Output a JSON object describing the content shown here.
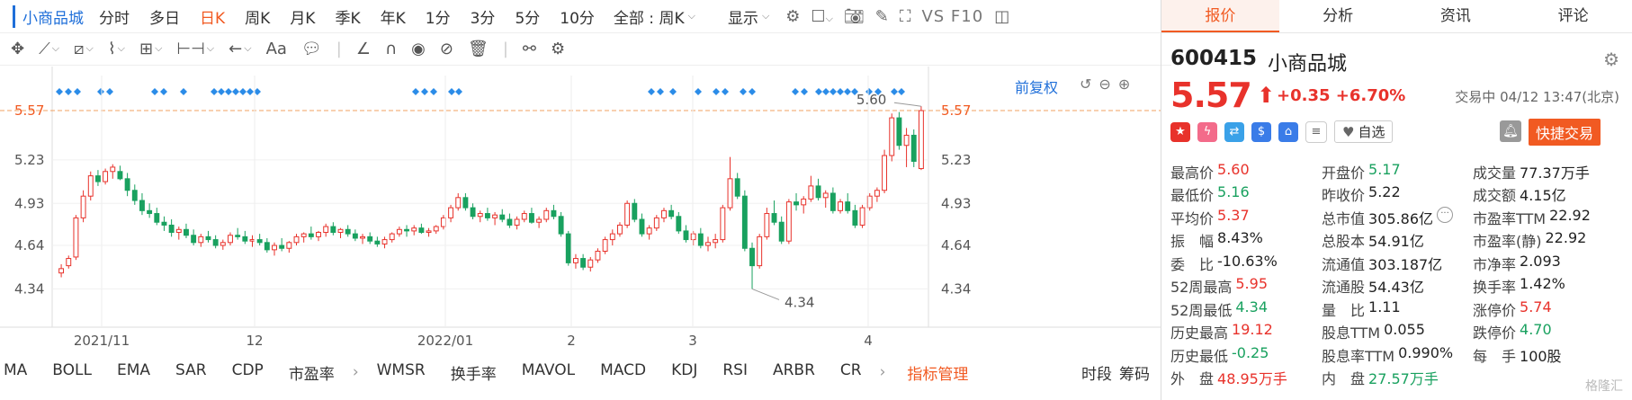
{
  "toolbar": {
    "stock_name": "小商品城",
    "periods": [
      "分时",
      "多日",
      "日K",
      "周K",
      "月K",
      "季K",
      "年K",
      "1分",
      "3分",
      "5分",
      "10分"
    ],
    "active_period": "日K",
    "period_dropdown": "全部 : 周K",
    "display_label": "显示",
    "vs_f10": "VS F10"
  },
  "drawing_tools_icons": [
    "crosshair-icon",
    "line-icon",
    "channel-icon",
    "wave-icon",
    "fib-icon",
    "range-icon",
    "arrow-icon",
    "text-icon",
    "comment-icon",
    "pen-icon",
    "magnet-icon",
    "eye-icon",
    "hide-icon",
    "delete-icon",
    "link-icon",
    "gear-icon"
  ],
  "chart": {
    "fuquan": "前复权",
    "y_ticks": [
      "5.57",
      "5.23",
      "4.93",
      "4.64",
      "4.34"
    ],
    "right_ticks": [
      "5.57",
      "5.23",
      "4.93",
      "4.64",
      "4.34"
    ],
    "x_ticks": [
      "2021/11",
      "12",
      "2022/01",
      "2",
      "3",
      "4"
    ],
    "high_label": "5.60",
    "low_label": "4.34"
  },
  "chart_data": {
    "type": "candlestick",
    "current_price": 5.57,
    "ylim": [
      4.2,
      5.75
    ],
    "candles": [
      [
        4.45,
        4.51,
        4.42,
        4.48
      ],
      [
        4.5,
        4.57,
        4.48,
        4.55
      ],
      [
        4.56,
        4.85,
        4.54,
        4.83
      ],
      [
        4.83,
        5.02,
        4.8,
        4.98
      ],
      [
        4.98,
        5.15,
        4.95,
        5.12
      ],
      [
        5.12,
        5.16,
        5.05,
        5.08
      ],
      [
        5.08,
        5.17,
        5.06,
        5.15
      ],
      [
        5.15,
        5.2,
        5.1,
        5.18
      ],
      [
        5.15,
        5.19,
        5.09,
        5.1
      ],
      [
        5.1,
        5.14,
        4.98,
        5.02
      ],
      [
        5.02,
        5.06,
        4.92,
        4.95
      ],
      [
        4.95,
        5.0,
        4.85,
        4.88
      ],
      [
        4.88,
        4.93,
        4.83,
        4.86
      ],
      [
        4.86,
        4.9,
        4.78,
        4.8
      ],
      [
        4.8,
        4.84,
        4.74,
        4.78
      ],
      [
        4.78,
        4.82,
        4.7,
        4.73
      ],
      [
        4.73,
        4.77,
        4.68,
        4.75
      ],
      [
        4.75,
        4.79,
        4.69,
        4.71
      ],
      [
        4.71,
        4.75,
        4.64,
        4.66
      ],
      [
        4.66,
        4.72,
        4.63,
        4.7
      ],
      [
        4.7,
        4.74,
        4.66,
        4.68
      ],
      [
        4.68,
        4.71,
        4.62,
        4.64
      ],
      [
        4.64,
        4.68,
        4.61,
        4.66
      ],
      [
        4.66,
        4.73,
        4.64,
        4.71
      ],
      [
        4.71,
        4.76,
        4.68,
        4.7
      ],
      [
        4.7,
        4.74,
        4.65,
        4.67
      ],
      [
        4.67,
        4.71,
        4.63,
        4.68
      ],
      [
        4.68,
        4.72,
        4.64,
        4.66
      ],
      [
        4.66,
        4.69,
        4.59,
        4.61
      ],
      [
        4.61,
        4.66,
        4.57,
        4.64
      ],
      [
        4.64,
        4.69,
        4.6,
        4.62
      ],
      [
        4.62,
        4.67,
        4.59,
        4.66
      ],
      [
        4.66,
        4.72,
        4.64,
        4.7
      ],
      [
        4.7,
        4.73,
        4.66,
        4.72
      ],
      [
        4.72,
        4.77,
        4.68,
        4.7
      ],
      [
        4.7,
        4.74,
        4.67,
        4.73
      ],
      [
        4.73,
        4.79,
        4.7,
        4.77
      ],
      [
        4.77,
        4.8,
        4.71,
        4.73
      ],
      [
        4.73,
        4.76,
        4.69,
        4.75
      ],
      [
        4.75,
        4.78,
        4.7,
        4.72
      ],
      [
        4.72,
        4.75,
        4.67,
        4.69
      ],
      [
        4.69,
        4.72,
        4.65,
        4.7
      ],
      [
        4.7,
        4.73,
        4.65,
        4.67
      ],
      [
        4.67,
        4.7,
        4.63,
        4.65
      ],
      [
        4.65,
        4.7,
        4.62,
        4.68
      ],
      [
        4.68,
        4.73,
        4.66,
        4.72
      ],
      [
        4.72,
        4.77,
        4.7,
        4.75
      ],
      [
        4.75,
        4.78,
        4.7,
        4.74
      ],
      [
        4.74,
        4.78,
        4.71,
        4.76
      ],
      [
        4.76,
        4.79,
        4.72,
        4.73
      ],
      [
        4.73,
        4.76,
        4.7,
        4.74
      ],
      [
        4.74,
        4.78,
        4.72,
        4.77
      ],
      [
        4.77,
        4.85,
        4.75,
        4.83
      ],
      [
        4.83,
        4.92,
        4.8,
        4.9
      ],
      [
        4.9,
        5.0,
        4.88,
        4.97
      ],
      [
        4.97,
        5.0,
        4.88,
        4.9
      ],
      [
        4.9,
        4.93,
        4.82,
        4.84
      ],
      [
        4.84,
        4.88,
        4.8,
        4.86
      ],
      [
        4.86,
        4.9,
        4.81,
        4.83
      ],
      [
        4.83,
        4.87,
        4.78,
        4.85
      ],
      [
        4.85,
        4.89,
        4.8,
        4.82
      ],
      [
        4.82,
        4.86,
        4.76,
        4.78
      ],
      [
        4.78,
        4.84,
        4.75,
        4.82
      ],
      [
        4.82,
        4.88,
        4.8,
        4.86
      ],
      [
        4.86,
        4.9,
        4.79,
        4.8
      ],
      [
        4.8,
        4.84,
        4.76,
        4.82
      ],
      [
        4.82,
        4.9,
        4.8,
        4.88
      ],
      [
        4.88,
        4.92,
        4.82,
        4.84
      ],
      [
        4.84,
        4.87,
        4.7,
        4.72
      ],
      [
        4.72,
        4.74,
        4.5,
        4.52
      ],
      [
        4.52,
        4.58,
        4.48,
        4.55
      ],
      [
        4.55,
        4.58,
        4.47,
        4.49
      ],
      [
        4.49,
        4.56,
        4.46,
        4.54
      ],
      [
        4.54,
        4.62,
        4.52,
        4.6
      ],
      [
        4.6,
        4.7,
        4.58,
        4.68
      ],
      [
        4.68,
        4.75,
        4.64,
        4.72
      ],
      [
        4.72,
        4.8,
        4.7,
        4.78
      ],
      [
        4.78,
        4.95,
        4.76,
        4.93
      ],
      [
        4.93,
        4.96,
        4.8,
        4.82
      ],
      [
        4.82,
        4.86,
        4.7,
        4.72
      ],
      [
        4.72,
        4.78,
        4.68,
        4.76
      ],
      [
        4.76,
        4.85,
        4.74,
        4.83
      ],
      [
        4.83,
        4.9,
        4.8,
        4.88
      ],
      [
        4.88,
        4.92,
        4.82,
        4.84
      ],
      [
        4.84,
        4.87,
        4.72,
        4.74
      ],
      [
        4.74,
        4.78,
        4.66,
        4.68
      ],
      [
        4.68,
        4.74,
        4.64,
        4.72
      ],
      [
        4.72,
        4.76,
        4.62,
        4.64
      ],
      [
        4.64,
        4.7,
        4.6,
        4.66
      ],
      [
        4.66,
        4.72,
        4.62,
        4.68
      ],
      [
        4.68,
        4.92,
        4.66,
        4.9
      ],
      [
        4.9,
        5.25,
        4.88,
        5.1
      ],
      [
        5.1,
        5.14,
        4.96,
        4.98
      ],
      [
        4.98,
        5.02,
        4.6,
        4.62
      ],
      [
        4.62,
        4.66,
        4.34,
        4.5
      ],
      [
        4.5,
        4.72,
        4.48,
        4.7
      ],
      [
        4.7,
        4.9,
        4.68,
        4.86
      ],
      [
        4.86,
        4.95,
        4.78,
        4.8
      ],
      [
        4.8,
        4.84,
        4.65,
        4.67
      ],
      [
        4.67,
        4.96,
        4.65,
        4.94
      ],
      [
        4.94,
        5.0,
        4.88,
        4.92
      ],
      [
        4.92,
        4.98,
        4.86,
        4.96
      ],
      [
        4.96,
        5.12,
        4.94,
        5.05
      ],
      [
        5.05,
        5.1,
        4.95,
        4.97
      ],
      [
        4.97,
        5.02,
        4.9,
        5.0
      ],
      [
        5.0,
        5.04,
        4.86,
        4.88
      ],
      [
        4.88,
        4.96,
        4.86,
        4.94
      ],
      [
        4.94,
        5.0,
        4.86,
        4.88
      ],
      [
        4.88,
        4.92,
        4.76,
        4.78
      ],
      [
        4.78,
        4.92,
        4.76,
        4.9
      ],
      [
        4.9,
        5.0,
        4.88,
        4.98
      ],
      [
        4.98,
        5.04,
        4.94,
        5.02
      ],
      [
        5.02,
        5.3,
        5.0,
        5.26
      ],
      [
        5.26,
        5.55,
        5.22,
        5.52
      ],
      [
        5.52,
        5.56,
        5.3,
        5.33
      ],
      [
        5.33,
        5.45,
        5.18,
        5.4
      ],
      [
        5.4,
        5.44,
        5.18,
        5.22
      ],
      [
        5.17,
        5.6,
        5.16,
        5.57
      ]
    ],
    "markers": [
      3,
      7,
      8,
      10,
      13,
      16,
      18,
      21,
      24,
      27,
      30,
      33,
      36,
      39,
      42
    ]
  },
  "indicators": {
    "list1": [
      "MA",
      "BOLL",
      "EMA",
      "SAR",
      "CDP",
      "市盈率"
    ],
    "list2": [
      "WMSR",
      "换手率",
      "MAVOL",
      "MACD",
      "KDJ",
      "RSI",
      "ARBR",
      "CR"
    ],
    "management": "指标管理",
    "tail": [
      "时段",
      "筹码"
    ]
  },
  "panel": {
    "tabs": [
      "报价",
      "分析",
      "资讯",
      "评论"
    ],
    "active_tab": "报价",
    "code": "600415",
    "name": "小商品城",
    "price": "5.57",
    "change": "+0.35",
    "change_pct": "+6.70%",
    "status": "交易中 04/12 13:47(北京)",
    "watch_label": "自选",
    "quick_trade": "快捷交易",
    "rows": [
      [
        [
          "最高价",
          "5.60",
          "up"
        ],
        [
          "开盘价",
          "5.17",
          "dn"
        ],
        [
          "成交量",
          "77.37万手",
          "nt"
        ]
      ],
      [
        [
          "最低价",
          "5.16",
          "dn"
        ],
        [
          "昨收价",
          "5.22",
          "nt"
        ],
        [
          "成交额",
          "4.15亿",
          "nt"
        ]
      ],
      [
        [
          "平均价",
          "5.37",
          "up"
        ],
        [
          "总市值",
          "305.86亿",
          "nt"
        ],
        [
          "市盈率TTM",
          "22.92",
          "nt"
        ]
      ],
      [
        [
          "振　幅",
          "8.43%",
          "nt"
        ],
        [
          "总股本",
          "54.91亿",
          "nt"
        ],
        [
          "市盈率(静)",
          "22.92",
          "nt"
        ]
      ],
      [
        [
          "委　比",
          "-10.63%",
          "nt"
        ],
        [
          "流通值",
          "303.187亿",
          "nt"
        ],
        [
          "市净率",
          "2.093",
          "nt"
        ]
      ],
      [
        [
          "52周最高",
          "5.95",
          "up"
        ],
        [
          "流通股",
          "54.43亿",
          "nt"
        ],
        [
          "换手率",
          "1.42%",
          "nt"
        ]
      ],
      [
        [
          "52周最低",
          "4.34",
          "dn"
        ],
        [
          "量　比",
          "1.11",
          "nt"
        ],
        [
          "涨停价",
          "5.74",
          "up"
        ]
      ],
      [
        [
          "历史最高",
          "19.12",
          "up"
        ],
        [
          "股息TTM",
          "0.055",
          "nt"
        ],
        [
          "跌停价",
          "4.70",
          "dn"
        ]
      ],
      [
        [
          "历史最低",
          "-0.25",
          "dn"
        ],
        [
          "股息率TTM",
          "0.990%",
          "nt"
        ],
        [
          "每　手",
          "100股",
          "nt"
        ]
      ],
      [
        [
          "外　盘",
          "48.95万手",
          "up"
        ],
        [
          "内　盘",
          "27.57万手",
          "dn"
        ],
        [
          "",
          ""
        ]
      ]
    ],
    "watermark": "格隆汇"
  },
  "colors": {
    "accent": "#f15a22",
    "up": "#e8322b",
    "down": "#19a15f",
    "link": "#1f6fd9"
  }
}
